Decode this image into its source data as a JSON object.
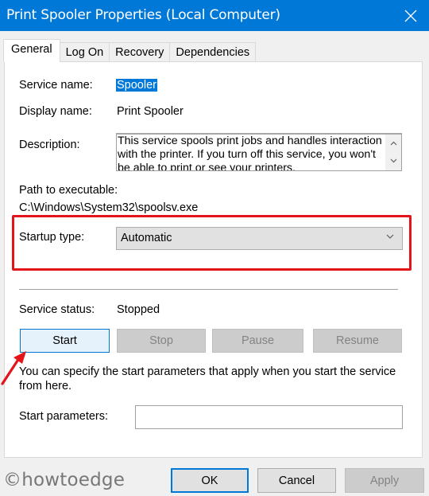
{
  "window": {
    "title": "Print Spooler Properties (Local Computer)",
    "close_icon": "close-icon"
  },
  "tabs": [
    {
      "label": "General",
      "active": true
    },
    {
      "label": "Log On",
      "active": false
    },
    {
      "label": "Recovery",
      "active": false
    },
    {
      "label": "Dependencies",
      "active": false
    }
  ],
  "general": {
    "service_name_label": "Service name:",
    "service_name_value": "Spooler",
    "display_name_label": "Display name:",
    "display_name_value": "Print Spooler",
    "description_label": "Description:",
    "description_value": "This service spools print jobs and handles interaction with the printer.  If you turn off this service, you won't be able to print or see your printers.",
    "path_label": "Path to executable:",
    "path_value": "C:\\Windows\\System32\\spoolsv.exe",
    "startup_type_label": "Startup type:",
    "startup_type_value": "Automatic",
    "service_status_label": "Service status:",
    "service_status_value": "Stopped",
    "buttons": {
      "start": "Start",
      "stop": "Stop",
      "pause": "Pause",
      "resume": "Resume"
    },
    "start_params_help": "You can specify the start parameters that apply when you start the service from here.",
    "start_params_label": "Start parameters:",
    "start_params_value": ""
  },
  "footer": {
    "ok": "OK",
    "cancel": "Cancel",
    "apply": "Apply"
  },
  "watermark": "©howtoedge",
  "annotations": {
    "highlight_color": "#e3151a",
    "highlight_target": "startup-type",
    "arrow_target": "start-button"
  },
  "colors": {
    "accent": "#0078d7",
    "selection": "#0078d7",
    "disabled_button": "#cccccc"
  }
}
